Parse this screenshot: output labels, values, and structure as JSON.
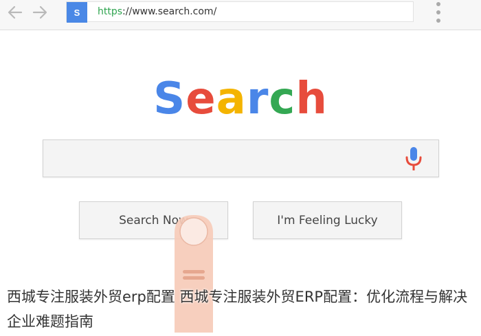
{
  "browser": {
    "favicon_letter": "S",
    "url_scheme": "https",
    "url_rest": "://www.search.com/",
    "back_icon": "arrow-left-icon",
    "forward_icon": "arrow-right-icon",
    "menu_icon": "kebab-menu-icon"
  },
  "logo": {
    "letters": [
      {
        "char": "S",
        "color": "#4a86e8"
      },
      {
        "char": "e",
        "color": "#e74c3c"
      },
      {
        "char": "a",
        "color": "#f4b400"
      },
      {
        "char": "r",
        "color": "#4a86e8"
      },
      {
        "char": "c",
        "color": "#34a853"
      },
      {
        "char": "h",
        "color": "#e74c3c"
      }
    ]
  },
  "search": {
    "value": "",
    "mic_icon": "microphone-icon"
  },
  "buttons": {
    "search_now": "Search Now",
    "feeling_lucky": "I'm Feeling Lucky"
  },
  "caption": {
    "text": "西城专注服装外贸erp配置 西城专注服装外贸ERP配置：优化流程与解决企业难题指南"
  },
  "colors": {
    "mic_blue": "#4a86e8",
    "mic_red": "#e74c3c",
    "favicon": "#4a88e6",
    "finger": "#f6cbb9"
  }
}
